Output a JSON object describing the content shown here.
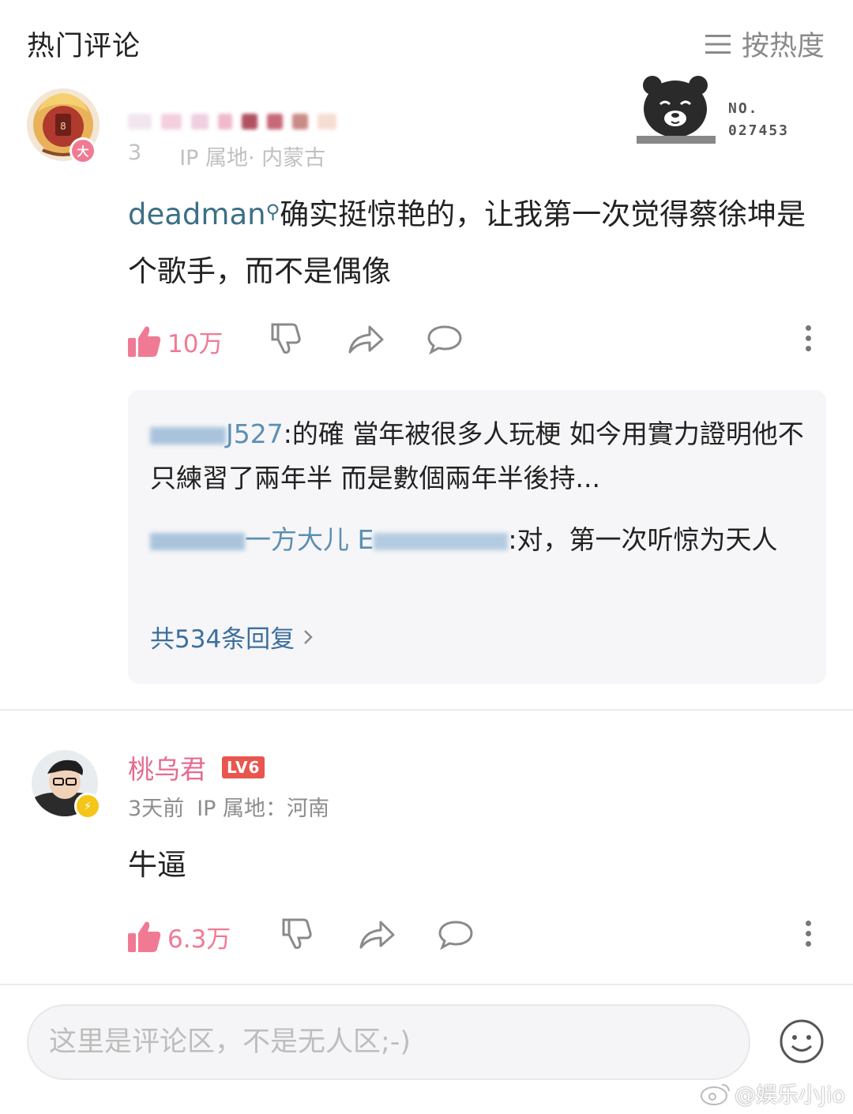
{
  "header": {
    "title": "热门评论",
    "sort_label": "按热度"
  },
  "comment1": {
    "meta_partial": "3",
    "meta_ip_partial": "IP 属地· 内蒙古",
    "mention": "deadman",
    "text": "确实挺惊艳的，让我第一次觉得蔡徐坤是个歌手，而不是偶像",
    "likes": "10万",
    "sticker": {
      "no_label": "NO.",
      "number": "027453"
    },
    "replies": [
      {
        "user_partial": "J527",
        "text": "的確 當年被很多人玩梗 如今用實力證明他不只練習了兩年半 而是數個兩年半後持..."
      },
      {
        "user_partial": "一方大儿 E",
        "text": "对，第一次听惊为天人"
      }
    ],
    "reply_count_label": "共534条回复"
  },
  "comment2": {
    "username": "桃乌君",
    "level": "LV6",
    "time": "3天前",
    "ip": "IP 属地：河南",
    "text": "牛逼",
    "likes": "6.3万"
  },
  "input": {
    "placeholder": "这里是评论区，不是无人区;-)"
  },
  "watermark": "@娱乐小Jio",
  "colors": {
    "accent_pink": "#f07a94",
    "username_pink": "#e56b8f",
    "mention_blue": "#3c6f86",
    "level_red": "#e8564e"
  },
  "icons": [
    "sort-icon",
    "like-icon",
    "dislike-icon",
    "share-icon",
    "comment-icon",
    "more-icon",
    "chevron-right-icon",
    "emoji-icon",
    "weibo-icon"
  ]
}
